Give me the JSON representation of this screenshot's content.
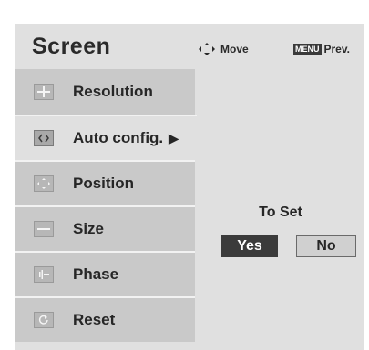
{
  "screen": {
    "title": "Screen",
    "hints": {
      "move_label": "Move",
      "menu_key": "MENU",
      "prev_label": "Prev."
    }
  },
  "menu": {
    "items": [
      {
        "label": "Resolution",
        "icon": "plus-icon",
        "active": false
      },
      {
        "label": "Auto config.",
        "icon": "auto-config-icon",
        "active": true,
        "arrow": "▶"
      },
      {
        "label": "Position",
        "icon": "position-icon",
        "active": false
      },
      {
        "label": "Size",
        "icon": "minus-icon",
        "active": false
      },
      {
        "label": "Phase",
        "icon": "phase-icon",
        "active": false
      },
      {
        "label": "Reset",
        "icon": "reset-icon",
        "active": false
      }
    ]
  },
  "dialog": {
    "prompt": "To Set",
    "yes_label": "Yes",
    "no_label": "No",
    "selected": "Yes"
  },
  "colors": {
    "panel": "#e0e0e0",
    "menu_item": "#c9c9c9",
    "selected_button": "#3b3b3b"
  }
}
